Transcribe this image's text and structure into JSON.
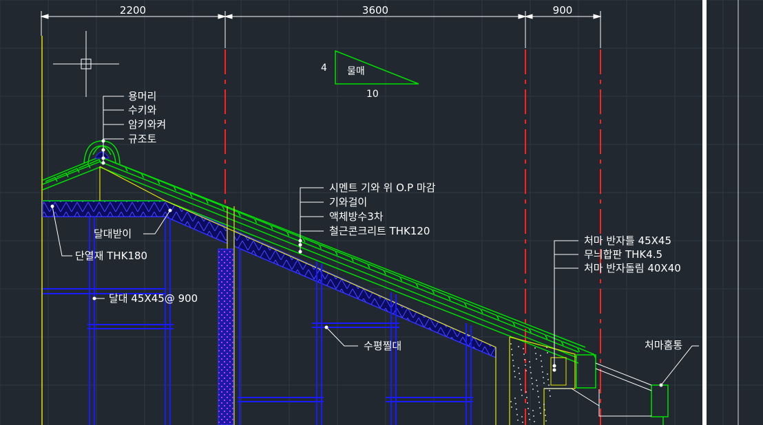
{
  "dimensions": [
    "2200",
    "3600",
    "900"
  ],
  "slope": {
    "rise": "4",
    "run": "10",
    "label": "물매"
  },
  "ridge_labels": [
    "용머리",
    "수키와",
    "암키와켜",
    "규조토"
  ],
  "roof_labels": [
    "시멘트 기와 위 O.P 마감",
    "기와걸이",
    "액체방수3차",
    "철근콘크리트 THK120"
  ],
  "eave_labels": [
    "처마 반자틀 45X45",
    "무늬합판 THK4.5",
    "처마 반자돌림 40X40"
  ],
  "misc_labels": {
    "ceiling_joist_hanger": "달대받이",
    "insulation": "단열재 THK180",
    "ceiling_joist": "달대 45X45@ 900",
    "horizontal_member": "수평찔대",
    "gutter": "처마홈통"
  },
  "colors": {
    "background": "#212830",
    "grid": "#2f3843",
    "white": "#ffffff",
    "green": "#00e000",
    "blue": "#1a1aff",
    "yellow": "#e6e600",
    "red": "#ff2020",
    "magenta": "#ff30ff",
    "cyan": "#00d8d8"
  }
}
